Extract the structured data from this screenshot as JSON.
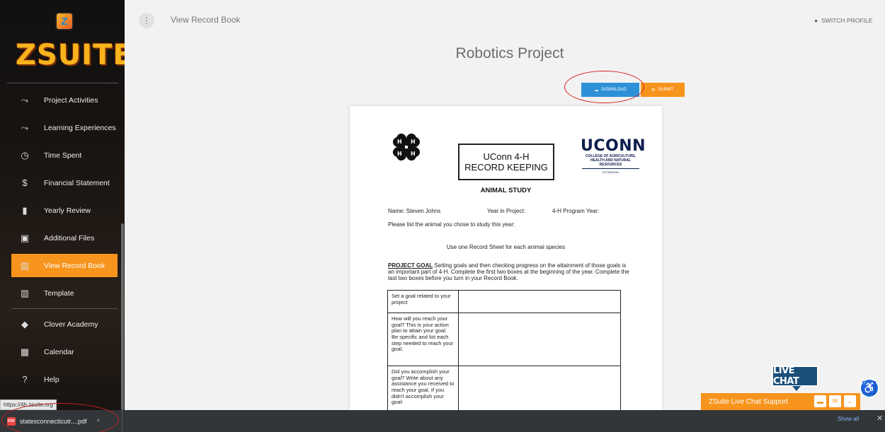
{
  "app": {
    "logo_mark": "Z",
    "logo_text": "ZSUITE"
  },
  "sidebar": {
    "items": [
      {
        "label": "Project Activities",
        "icon": "trend-icon"
      },
      {
        "label": "Learning Experiences",
        "icon": "trend-icon"
      },
      {
        "label": "Time Spent",
        "icon": "clock-icon"
      },
      {
        "label": "Financial Statement",
        "icon": "dollar-icon"
      },
      {
        "label": "Yearly Review",
        "icon": "book-icon"
      },
      {
        "label": "Additional Files",
        "icon": "image-icon"
      },
      {
        "label": "View Record Book",
        "icon": "open-book-icon",
        "active": true
      },
      {
        "label": "Template",
        "icon": "open-book-icon"
      },
      {
        "label": "Clover Academy",
        "icon": "graduation-cap-icon"
      },
      {
        "label": "Calendar",
        "icon": "calendar-icon"
      },
      {
        "label": "Help",
        "icon": "help-icon"
      }
    ],
    "url_tooltip": "https://4h.zsuite.org"
  },
  "header": {
    "breadcrumb": "View Record Book",
    "switch_profile": "SWITCH PROFILE"
  },
  "main": {
    "title": "Robotics Project",
    "download_label": "DOWNLOAD",
    "submit_label": "SUBMIT"
  },
  "document": {
    "box_line1": "UConn 4-H",
    "box_line2": "RECORD KEEPING",
    "uconn_word": "UCONN",
    "uconn_sub1": "COLLEGE OF AGRICULTURE,",
    "uconn_sub2": "HEALTH AND NATURAL",
    "uconn_sub3": "RESOURCES",
    "uconn_ext": "EXTENSION",
    "heading": "ANIMAL STUDY",
    "name_field": "Name:  Steven Johns",
    "year_field": "Year in Project:",
    "program_field": "4-H Program Year:",
    "list_question": "Please list the animal you chose to study this year:",
    "use_one": "Use one Record Sheet for each animal species",
    "goal_label": "PROJECT GOAL",
    "goal_text": " Setting goals and then checking progress on the attainment of those goals is an important part of 4-H. Complete the first two boxes at the beginning of the year. Complete the last two boxes before you turn in your Record Book.",
    "table_rows": [
      "Set a goal related to your project",
      "How will you reach your goal? This is your action plan to attain your goal. Be specific and list each step needed to reach your goal.",
      "Did you accomplish your goal? Write about any assistance you received to reach your goal. If you didn't accomplish your goal-"
    ]
  },
  "live_chat": {
    "badge": "LIVE CHAT",
    "bar_label": "ZSuite Live Chat Support"
  },
  "download_bar": {
    "filename": "statesconnecticutr....pdf",
    "show_all": "Show all"
  },
  "colors": {
    "accent_orange": "#f7941d",
    "download_blue": "#2e91d8",
    "annotation_red": "#d72121"
  }
}
